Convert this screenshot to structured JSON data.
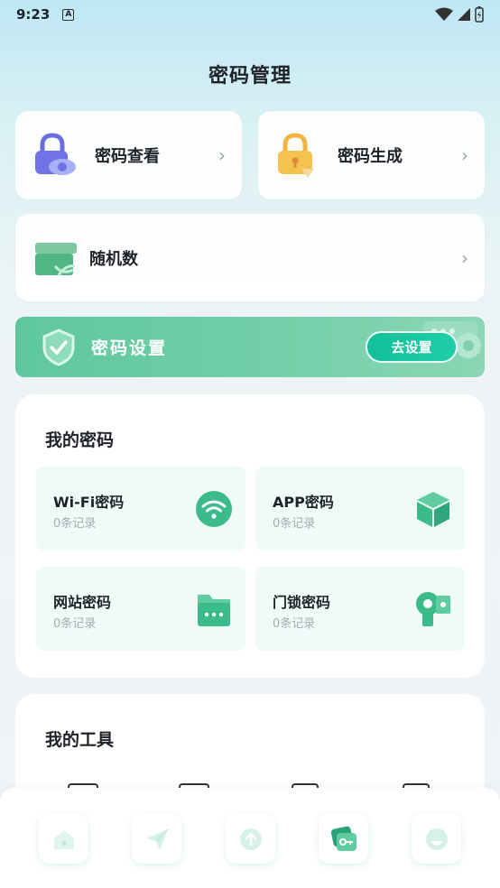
{
  "status_bar": {
    "time": "9:23",
    "notif_letter": "A"
  },
  "header": {
    "title": "密码管理"
  },
  "cards": {
    "view": {
      "label": "密码查看"
    },
    "generate": {
      "label": "密码生成"
    },
    "random": {
      "label": "随机数"
    }
  },
  "settings_banner": {
    "label": "密码设置",
    "button": "去设置"
  },
  "my_passwords": {
    "title": "我的密码",
    "items": [
      {
        "name": "Wi-Fi密码",
        "count": "0条记录",
        "icon": "wifi-icon"
      },
      {
        "name": "APP密码",
        "count": "0条记录",
        "icon": "cube-icon"
      },
      {
        "name": "网站密码",
        "count": "0条记录",
        "icon": "website-folder-icon"
      },
      {
        "name": "门锁密码",
        "count": "0条记录",
        "icon": "door-lock-icon"
      }
    ]
  },
  "my_tools": {
    "title": "我的工具"
  },
  "tabbar": {
    "tabs": [
      {
        "icon": "home-icon"
      },
      {
        "icon": "send-icon"
      },
      {
        "icon": "upload-icon"
      },
      {
        "icon": "key-cards-icon"
      },
      {
        "icon": "profile-icon"
      }
    ]
  },
  "colors": {
    "accent": "#1fc59e",
    "banner": "#6acb9f",
    "tile_bg": "#effbf6",
    "icon_green": "#3bba8c"
  }
}
